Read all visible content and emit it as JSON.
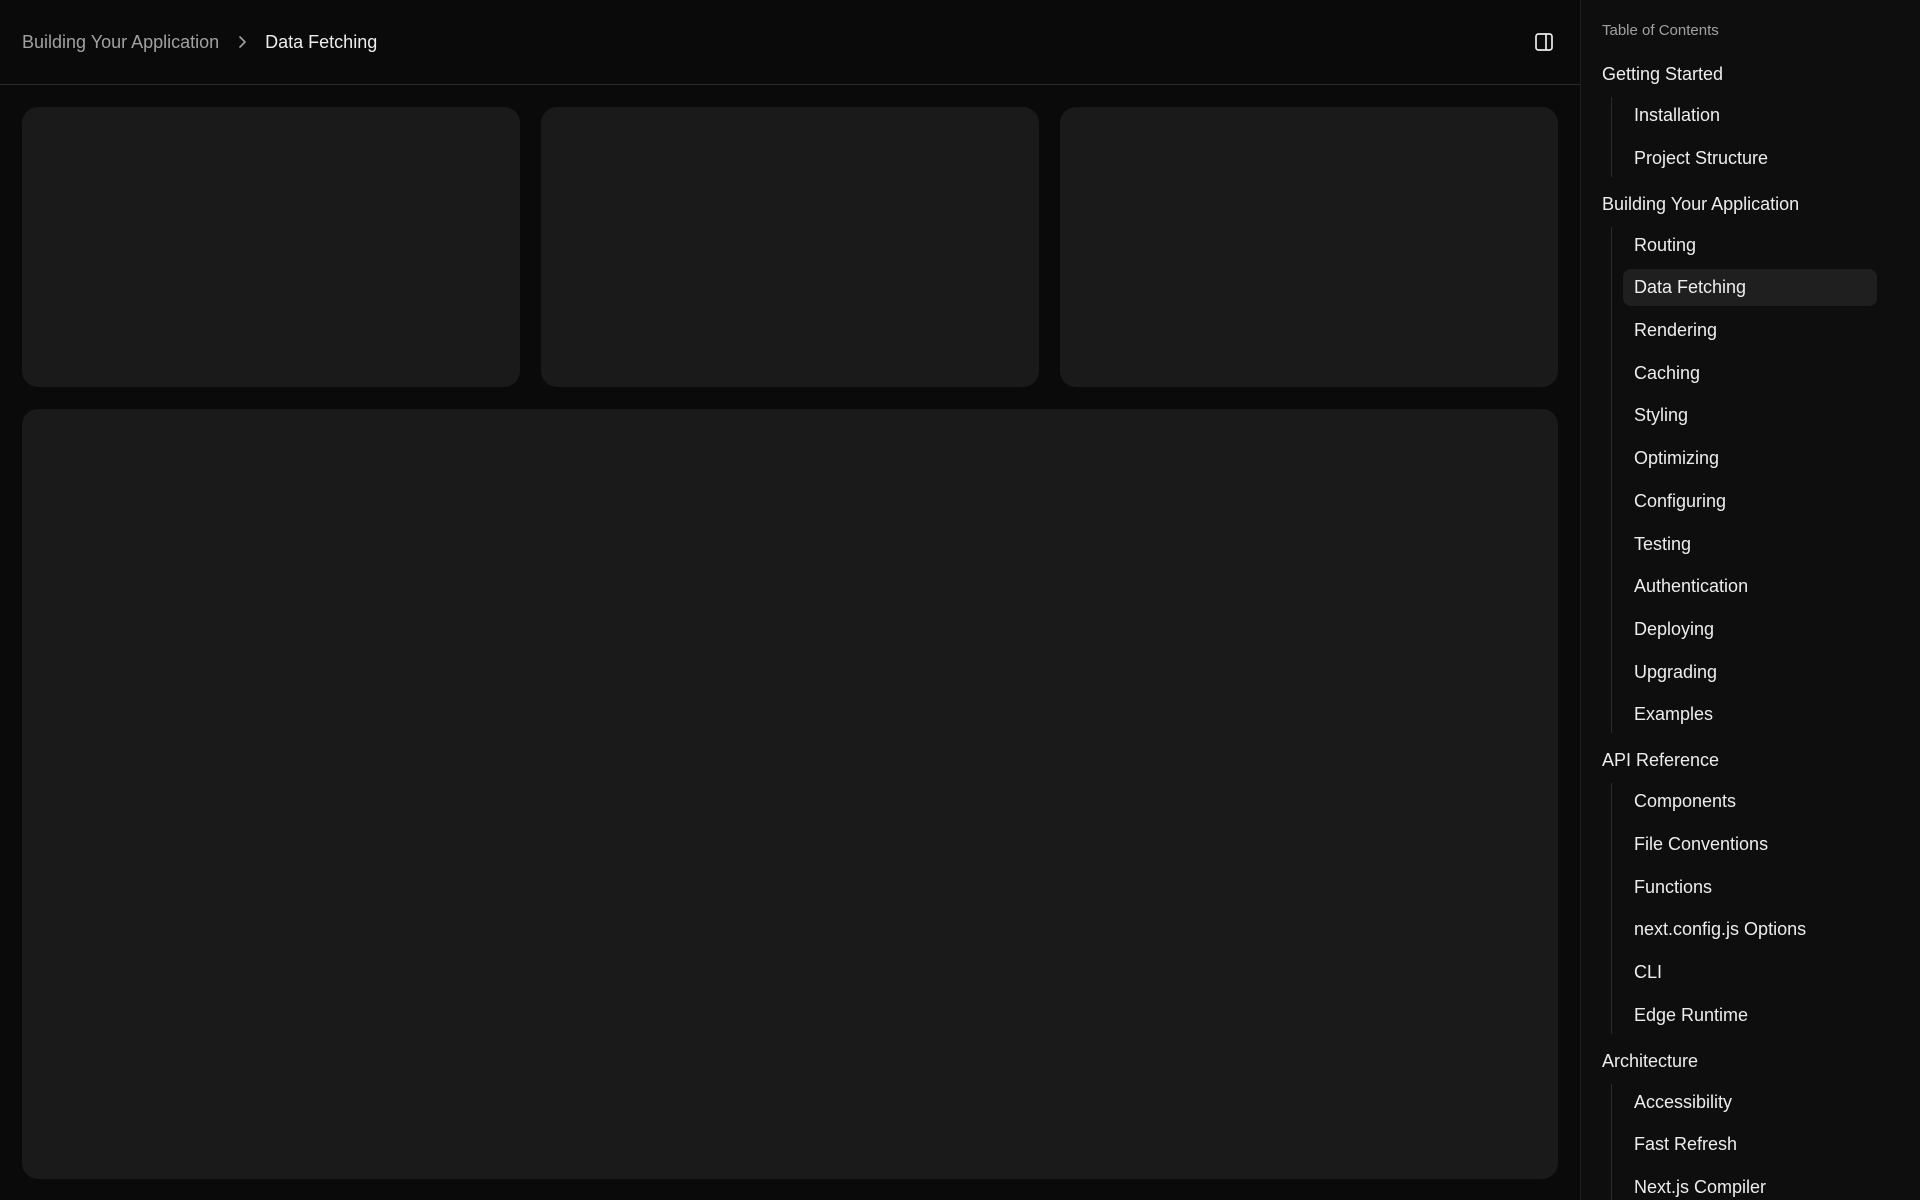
{
  "breadcrumb": {
    "parent": "Building Your Application",
    "current": "Data Fetching"
  },
  "icons": {
    "separator": "chevron-right-icon",
    "panel_toggle": "sidebar-panel-icon"
  },
  "toc": {
    "title": "Table of Contents",
    "sections": [
      {
        "title": "Getting Started",
        "items": [
          "Installation",
          "Project Structure"
        ]
      },
      {
        "title": "Building Your Application",
        "items": [
          "Routing",
          "Data Fetching",
          "Rendering",
          "Caching",
          "Styling",
          "Optimizing",
          "Configuring",
          "Testing",
          "Authentication",
          "Deploying",
          "Upgrading",
          "Examples"
        ]
      },
      {
        "title": "API Reference",
        "items": [
          "Components",
          "File Conventions",
          "Functions",
          "next.config.js Options",
          "CLI",
          "Edge Runtime"
        ]
      },
      {
        "title": "Architecture",
        "items": [
          "Accessibility",
          "Fast Refresh",
          "Next.js Compiler"
        ]
      }
    ],
    "active_item": "Data Fetching"
  },
  "colors": {
    "background": "#0a0a0a",
    "card": "#1a1a1a",
    "sidebar": "#0e0e0e",
    "active_item_bg": "#1f1f1f",
    "text_primary": "#ededed",
    "text_muted": "#a1a1a1"
  }
}
